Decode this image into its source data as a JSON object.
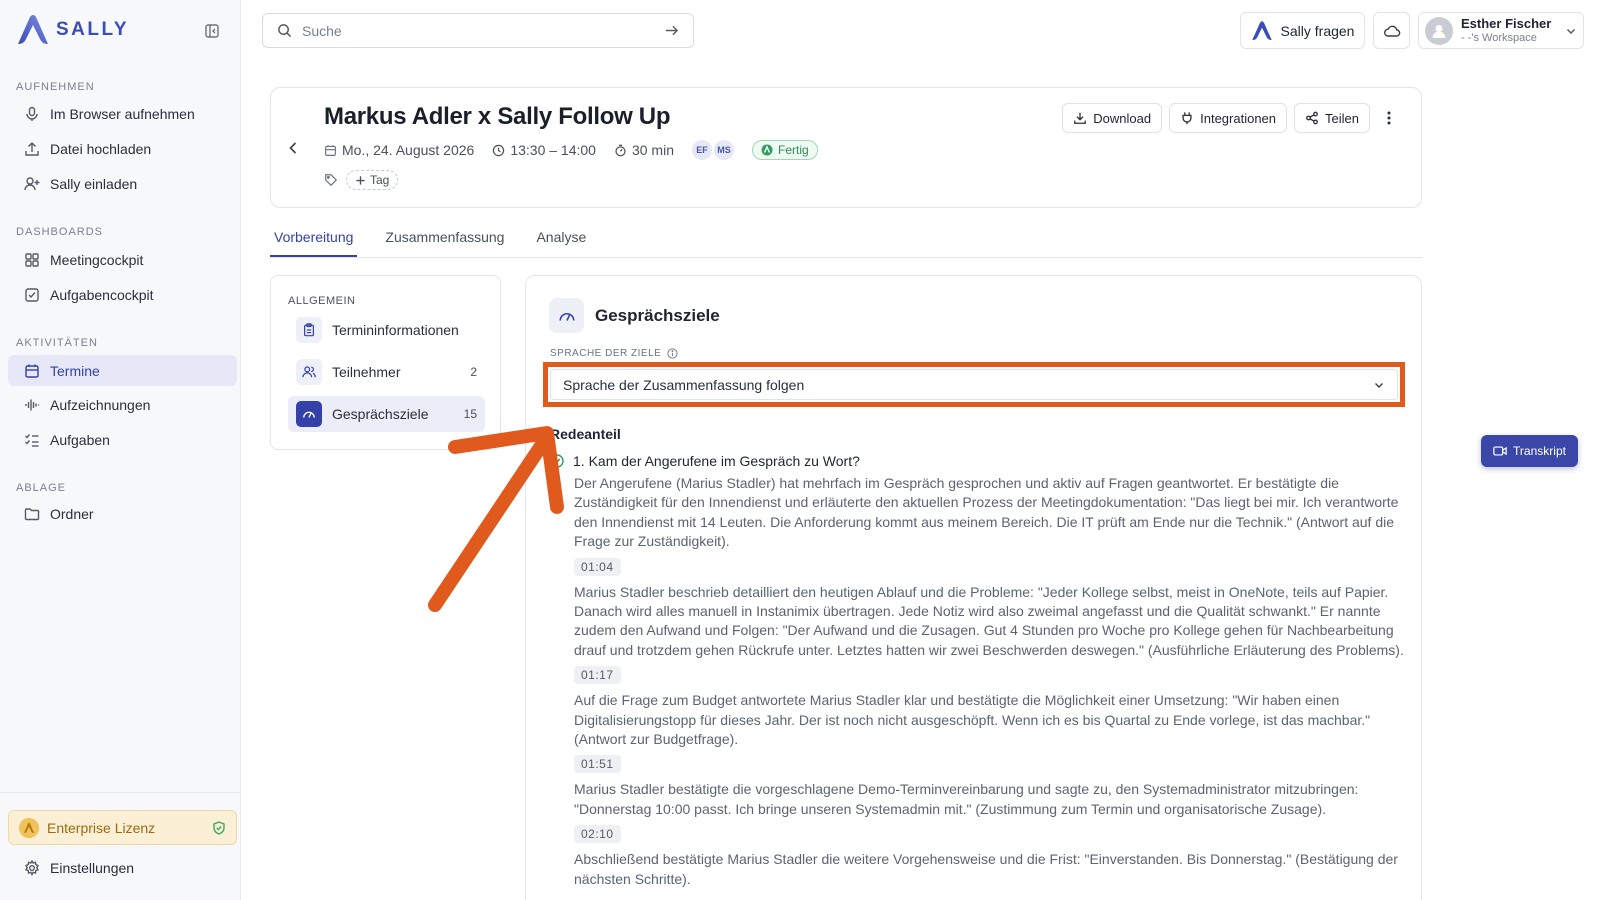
{
  "app": {
    "brand": "SALLY",
    "accent": "#3341a8",
    "highlight": "#e05a1d"
  },
  "sidebar": {
    "sections": [
      {
        "title": "AUFNEHMEN",
        "items": [
          {
            "label": "Im Browser aufnehmen",
            "icon": "mic-icon"
          },
          {
            "label": "Datei hochladen",
            "icon": "upload-icon"
          },
          {
            "label": "Sally einladen",
            "icon": "user-plus-icon"
          }
        ]
      },
      {
        "title": "DASHBOARDS",
        "items": [
          {
            "label": "Meetingcockpit",
            "icon": "grid-icon"
          },
          {
            "label": "Aufgabencockpit",
            "icon": "checkbox-icon"
          }
        ]
      },
      {
        "title": "AKTIVITÄTEN",
        "items": [
          {
            "label": "Termine",
            "icon": "calendar-icon",
            "active": true
          },
          {
            "label": "Aufzeichnungen",
            "icon": "waveform-icon"
          },
          {
            "label": "Aufgaben",
            "icon": "task-list-icon"
          }
        ]
      },
      {
        "title": "ABLAGE",
        "items": [
          {
            "label": "Ordner",
            "icon": "folder-icon"
          }
        ]
      }
    ],
    "license": "Enterprise Lizenz",
    "settings": "Einstellungen"
  },
  "topbar": {
    "search_placeholder": "Suche",
    "ask_label": "Sally fragen",
    "user_name": "Esther Fischer",
    "user_workspace": "- -'s Workspace"
  },
  "meeting": {
    "title": "Markus Adler x Sally Follow Up",
    "date": "Mo., 24. August 2026",
    "time": "13:30 – 14:00",
    "duration": "30 min",
    "participants": [
      "EF",
      "MS"
    ],
    "status": "Fertig",
    "tag_label": "Tag",
    "actions": {
      "download": "Download",
      "integrations": "Integrationen",
      "share": "Teilen"
    }
  },
  "tabs": [
    "Vorbereitung",
    "Zusammenfassung",
    "Analyse"
  ],
  "subnav": {
    "title": "ALLGEMEIN",
    "items": [
      {
        "label": "Termininformationen",
        "count": ""
      },
      {
        "label": "Teilnehmer",
        "count": "2"
      },
      {
        "label": "Gesprächsziele",
        "count": "15"
      }
    ]
  },
  "goals": {
    "title": "Gesprächsziele",
    "language_label": "SPRACHE DER ZIELE",
    "language_value": "Sprache der Zusammenfassung folgen",
    "section": "Redeanteil",
    "question": "1. Kam der Angerufene im Gespräch zu Wort?",
    "answers": [
      {
        "text": "Der Angerufene (Marius Stadler) hat mehrfach im Gespräch gesprochen und aktiv auf Fragen geantwortet. Er bestätigte die Zuständigkeit für den Innendienst und erläuterte den aktuellen Prozess der Meetingdokumentation: \"Das liegt bei mir. Ich verantworte den Innendienst mit 14 Leuten. Die Anforderung kommt aus meinem Bereich. Die IT prüft am Ende nur die Technik.\" (Antwort auf die Frage zur Zuständigkeit).",
        "time": "01:04"
      },
      {
        "text": "Marius Stadler beschrieb detailliert den heutigen Ablauf und die Probleme: \"Jeder Kollege selbst, meist in OneNote, teils auf Papier. Danach wird alles manuell in Instanimix übertragen. Jede Notiz wird also zweimal angefasst und die Qualität schwankt.\" Er nannte zudem den Aufwand und Folgen: \"Der Aufwand und die Zusagen. Gut 4 Stunden pro Woche pro Kollege gehen für Nachbearbeitung drauf und trotzdem gehen Rückrufe unter. Letztes hatten wir zwei Beschwerden deswegen.\" (Ausführliche Erläuterung des Problems).",
        "time": "01:17"
      },
      {
        "text": "Auf die Frage zum Budget antwortete Marius Stadler klar und bestätigte die Möglichkeit einer Umsetzung: \"Wir haben einen Digitalisierungstopp für dieses Jahr. Der ist noch nicht ausgeschöpft. Wenn ich es bis Quartal zu Ende vorlege, ist das machbar.\" (Antwort zur Budgetfrage).",
        "time": "01:51"
      },
      {
        "text": "Marius Stadler bestätigte die vorgeschlagene Demo-Terminvereinbarung und sagte zu, den Systemadministrator mitzubringen: \"Donnerstag 10:00 passt. Ich bringe unseren Systemadmin mit.\" (Zustimmung zum Termin und organisatorische Zusage).",
        "time": "02:10"
      },
      {
        "text": "Abschließend bestätigte Marius Stadler die weitere Vorgehensweise und die Frist: \"Einverstanden. Bis Donnerstag.\" (Bestätigung der nächsten Schritte).",
        "time": ""
      }
    ]
  },
  "transcript_label": "Transkript"
}
